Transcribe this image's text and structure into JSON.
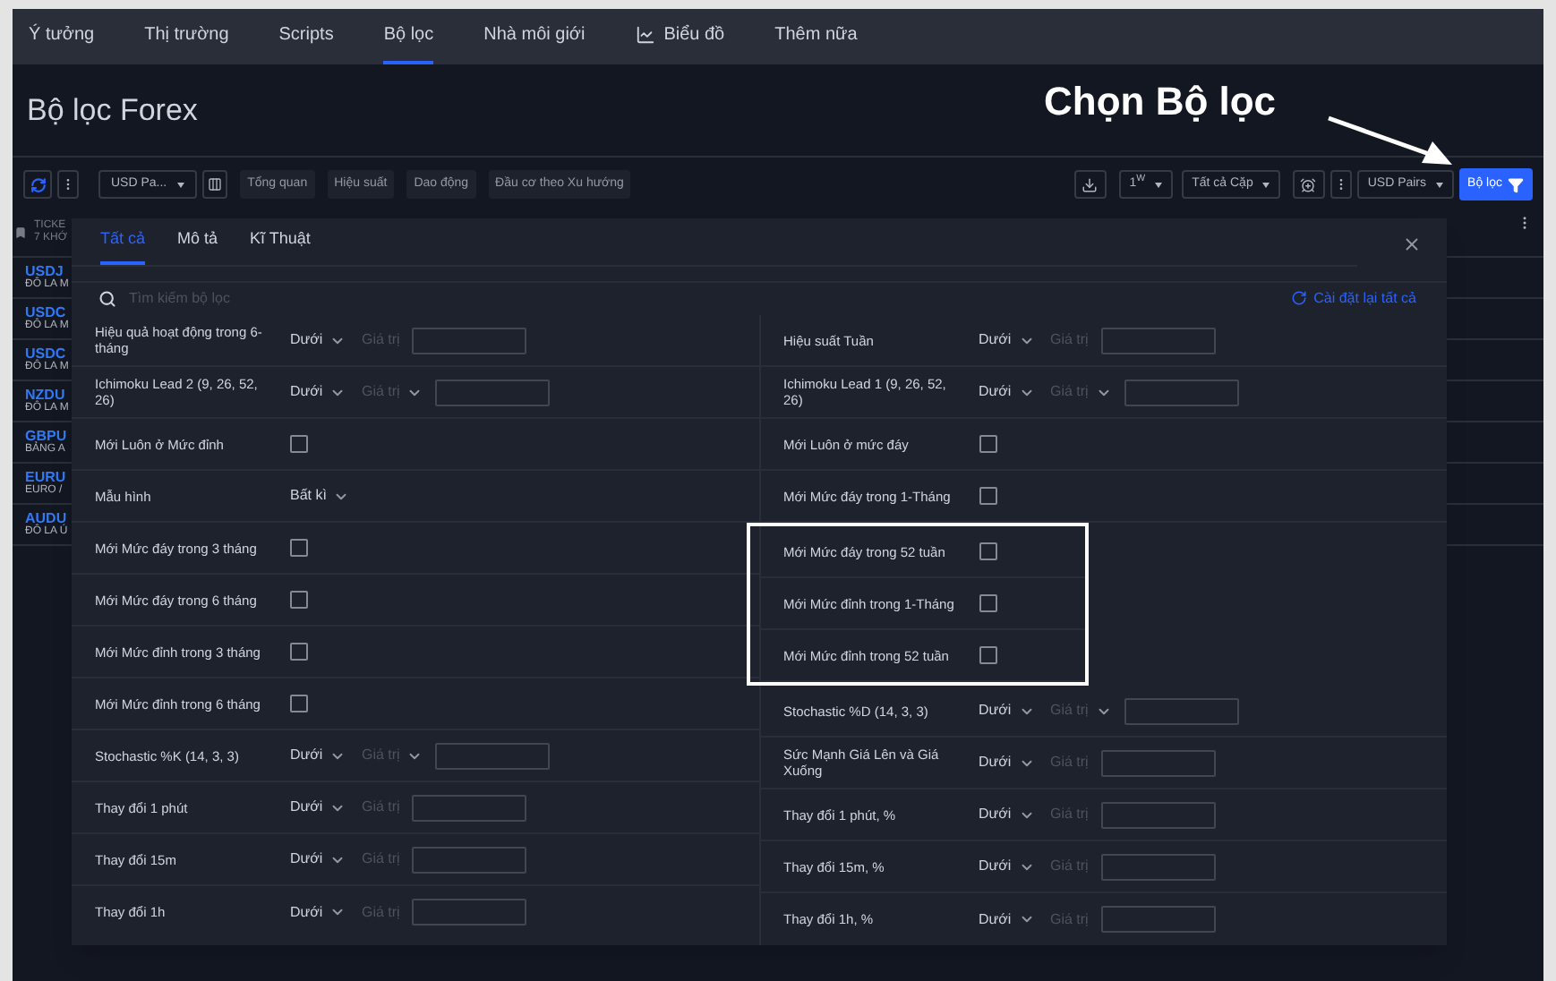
{
  "nav": {
    "items": [
      {
        "kind": "text",
        "label": "Ý tưởng",
        "selected": false
      },
      {
        "kind": "text",
        "label": "Thị trường",
        "selected": false
      },
      {
        "kind": "text",
        "label": "Scripts",
        "selected": false
      },
      {
        "kind": "text",
        "label": "Bộ lọc",
        "selected": true
      },
      {
        "kind": "text",
        "label": "Nhà môi giới",
        "selected": false
      },
      {
        "kind": "chart",
        "label": "Biểu đồ",
        "selected": false
      },
      {
        "kind": "text",
        "label": "Thêm nữa",
        "selected": false
      }
    ]
  },
  "page": {
    "title": "Bộ lọc Forex"
  },
  "annotation": {
    "text": "Chọn Bộ lọc"
  },
  "toolbar": {
    "list_select": "USD Pa...",
    "tabs": [
      "Tổng quan",
      "Hiệu suất",
      "Dao động",
      "Đầu cơ theo Xu hướng"
    ],
    "interval": "1$^{W}$",
    "pair_filter": "Tất cả Cặp",
    "pair_list": "USD Pairs",
    "filter_button": "Bộ lọc"
  },
  "table": {
    "header": {
      "title": "TICKE",
      "subtitle": "7 KHỚ"
    },
    "rows": [
      {
        "symbol": "USDJ",
        "name": "ĐÔ LA M"
      },
      {
        "symbol": "USDC",
        "name": "ĐÔ LA M"
      },
      {
        "symbol": "USDC",
        "name": "ĐÔ LA M"
      },
      {
        "symbol": "NZDU",
        "name": "ĐÔ LA M"
      },
      {
        "symbol": "GBPU",
        "name": "BẢNG A"
      },
      {
        "symbol": "EURU",
        "name": "EURO /"
      },
      {
        "symbol": "AUDU",
        "name": "ĐÔ LA Ú"
      }
    ]
  },
  "filter_dialog": {
    "tabs": [
      {
        "label": "Tất cả",
        "selected": true
      },
      {
        "label": "Mô tả",
        "selected": false
      },
      {
        "label": "Kĩ Thuật",
        "selected": false
      }
    ],
    "search": {
      "placeholder": "Tìm kiếm bộ lọc"
    },
    "reset": "Cài đặt lại tất cả",
    "columns": [
      [
        {
          "kind": "range",
          "label": "Hiệu quả hoạt động trong 6-tháng",
          "operator": "Dưới",
          "value_placeholder": "Giá trị",
          "value_menu": false,
          "highlighted": false
        },
        {
          "kind": "range",
          "label": "Ichimoku Lead 2 (9, 26, 52, 26)",
          "operator": "Dưới",
          "value_placeholder": "Giá trị",
          "value_menu": true,
          "highlighted": false
        },
        {
          "kind": "checkbox",
          "label": "Mới Luôn ở Mức đỉnh",
          "checked": false,
          "highlighted": false
        },
        {
          "kind": "select",
          "label": "Mẫu hình",
          "value": "Bất kì",
          "highlighted": false
        },
        {
          "kind": "checkbox",
          "label": "Mới Mức đáy trong 3 tháng",
          "checked": false,
          "highlighted": false
        },
        {
          "kind": "checkbox",
          "label": "Mới Mức đáy trong 6 tháng",
          "checked": false,
          "highlighted": false
        },
        {
          "kind": "checkbox",
          "label": "Mới Mức đỉnh trong 3 tháng",
          "checked": false,
          "highlighted": false
        },
        {
          "kind": "checkbox",
          "label": "Mới Mức đỉnh trong 6 tháng",
          "checked": false,
          "highlighted": false
        },
        {
          "kind": "range",
          "label": "Stochastic %K (14, 3, 3)",
          "operator": "Dưới",
          "value_placeholder": "Giá trị",
          "value_menu": true,
          "highlighted": false
        },
        {
          "kind": "range",
          "label": "Thay đổi 1 phút",
          "operator": "Dưới",
          "value_placeholder": "Giá trị",
          "value_menu": false,
          "highlighted": false
        },
        {
          "kind": "range",
          "label": "Thay đổi 15m",
          "operator": "Dưới",
          "value_placeholder": "Giá trị",
          "value_menu": false,
          "highlighted": false
        },
        {
          "kind": "range",
          "label": "Thay đổi 1h",
          "operator": "Dưới",
          "value_placeholder": "Giá trị",
          "value_menu": false,
          "highlighted": false
        }
      ],
      [
        {
          "kind": "range",
          "label": "Hiệu suất Tuần",
          "operator": "Dưới",
          "value_placeholder": "Giá trị",
          "value_menu": false,
          "highlighted": false
        },
        {
          "kind": "range",
          "label": "Ichimoku Lead 1 (9, 26, 52, 26)",
          "operator": "Dưới",
          "value_placeholder": "Giá trị",
          "value_menu": true,
          "highlighted": false
        },
        {
          "kind": "checkbox",
          "label": "Mới Luôn ở mức đáy",
          "checked": false,
          "highlighted": false
        },
        {
          "kind": "checkbox",
          "label": "Mới Mức đáy trong 1-Tháng",
          "checked": false,
          "highlighted": false
        },
        {
          "kind": "checkbox",
          "label": "Mới Mức đáy trong 52 tuần",
          "checked": false,
          "highlighted": true
        },
        {
          "kind": "checkbox",
          "label": "Mới Mức đỉnh trong 1-Tháng",
          "checked": false,
          "highlighted": true
        },
        {
          "kind": "checkbox",
          "label": "Mới Mức đỉnh trong 52 tuần",
          "checked": false,
          "highlighted": true
        },
        {
          "kind": "range",
          "label": "Stochastic %D (14, 3, 3)",
          "operator": "Dưới",
          "value_placeholder": "Giá trị",
          "value_menu": true,
          "highlighted": false
        },
        {
          "kind": "range",
          "label": "Sức Mạnh Giá Lên và Giá Xuống",
          "operator": "Dưới",
          "value_placeholder": "Giá trị",
          "value_menu": false,
          "highlighted": false
        },
        {
          "kind": "range",
          "label": "Thay đổi 1 phút, %",
          "operator": "Dưới",
          "value_placeholder": "Giá trị",
          "value_menu": false,
          "highlighted": false
        },
        {
          "kind": "range",
          "label": "Thay đổi 15m, %",
          "operator": "Dưới",
          "value_placeholder": "Giá trị",
          "value_menu": false,
          "highlighted": false
        },
        {
          "kind": "range",
          "label": "Thay đổi 1h, %",
          "operator": "Dưới",
          "value_placeholder": "Giá trị",
          "value_menu": false,
          "highlighted": false
        }
      ]
    ]
  }
}
